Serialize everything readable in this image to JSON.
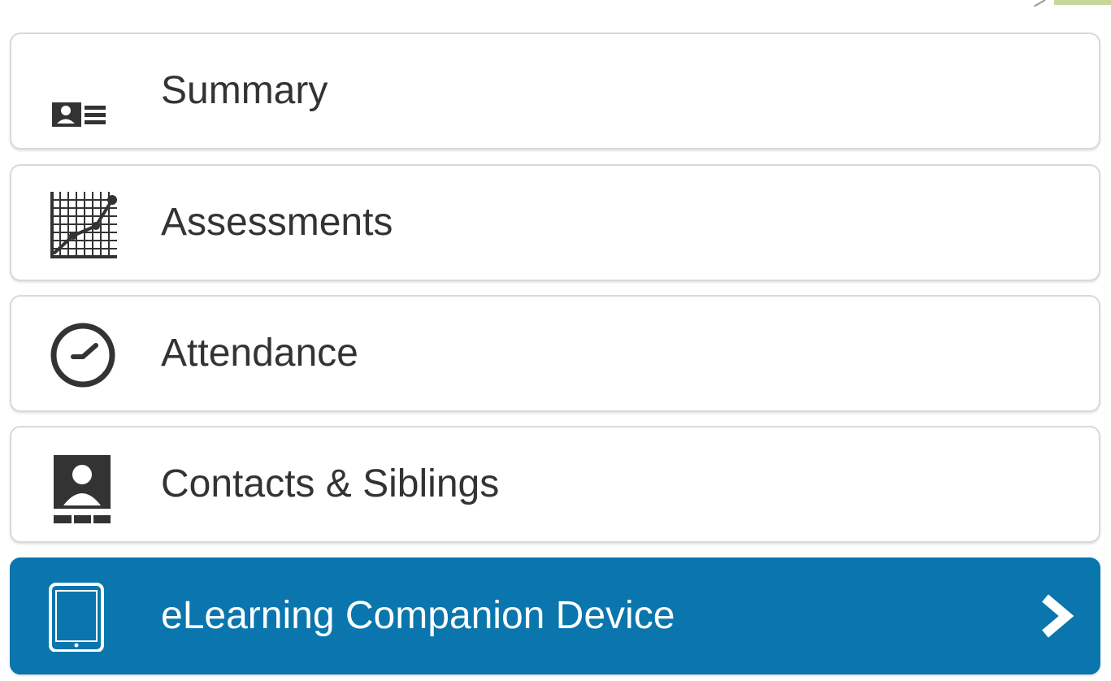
{
  "nav": {
    "items": [
      {
        "label": "Summary",
        "icon": "student-card-icon",
        "active": false
      },
      {
        "label": "Assessments",
        "icon": "line-graph-icon",
        "active": false
      },
      {
        "label": "Attendance",
        "icon": "clock-icon",
        "active": false
      },
      {
        "label": "Contacts & Siblings",
        "icon": "contact-person-icon",
        "active": false
      },
      {
        "label": "eLearning Companion Device",
        "icon": "tablet-icon",
        "active": true
      }
    ],
    "active_chevron": "chevron-right-icon"
  },
  "colors": {
    "active_bg": "#0a76ad",
    "text": "#333333",
    "icon": "#333333",
    "border": "#d9d9d9"
  }
}
